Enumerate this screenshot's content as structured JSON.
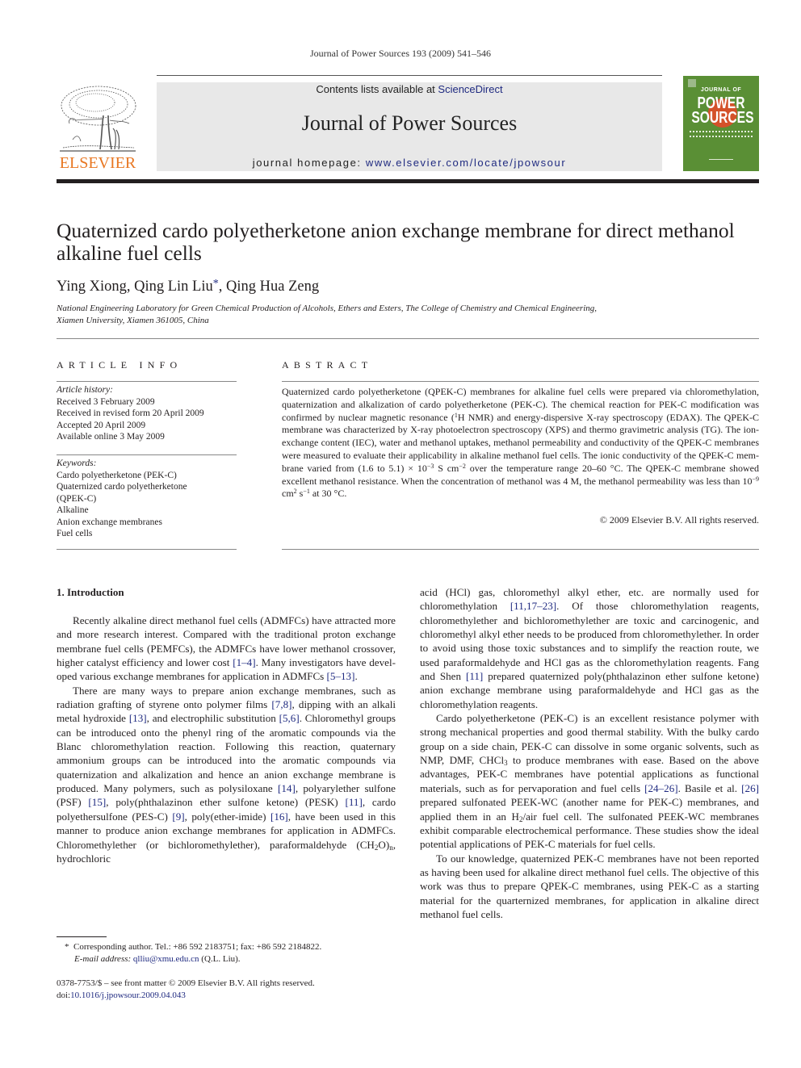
{
  "running_head": "Journal of Power Sources 193 (2009) 541–546",
  "publisher": {
    "logo_text": "ELSEVIER",
    "brand_color": "#e87722"
  },
  "banner": {
    "contents_prefix": "Contents lists available at ",
    "contents_link": "ScienceDirect",
    "journal_title": "Journal of Power Sources",
    "homepage_prefix": "journal homepage: ",
    "homepage_link": "www.elsevier.com/locate/jpowsour",
    "background": "#e8e8e8",
    "link_color": "#1f2a80"
  },
  "cover": {
    "small_title": "JOURNAL OF",
    "big_line1": "POWER",
    "big_line2": "SOURCES",
    "color": "#5a8f35"
  },
  "article": {
    "title": "Quaternized cardo polyetherketone anion exchange membrane for direct methanol alkaline fuel cells",
    "authors": [
      {
        "name": "Ying Xiong",
        "sep": ", "
      },
      {
        "name": "Qing Lin Liu",
        "mark": "*",
        "sep": ", "
      },
      {
        "name": "Qing Hua Zeng",
        "sep": ""
      }
    ],
    "affiliation_line1": "National Engineering Laboratory for Green Chemical Production of Alcohols, Ethers and Esters, The College of Chemistry and Chemical Engineering,",
    "affiliation_line2": "Xiamen University, Xiamen 361005, China"
  },
  "article_info": {
    "heading": "ARTICLE INFO",
    "history_label": "Article history:",
    "history": [
      "Received 3 February 2009",
      "Received in revised form 20 April 2009",
      "Accepted 20 April 2009",
      "Available online 3 May 2009"
    ],
    "keywords_label": "Keywords:",
    "keywords": [
      "Cardo polyetherketone (PEK-C)",
      "Quaternized cardo polyetherketone",
      "(QPEK-C)",
      "Alkaline",
      "Anion exchange membranes",
      "Fuel cells"
    ]
  },
  "abstract": {
    "heading": "ABSTRACT",
    "p1": "Quaternized cardo polyetherketone (QPEK-C) membranes for alkaline fuel cells were prepared via chloromethylation, quaternization and alkalization of cardo polyetherketone (PEK-C). The chemical reaction for PEK-C modification was confirmed by nuclear magnetic resonance (",
    "sup1": "1",
    "p2": "H NMR) and energy-dispersive X-ray spectroscopy (EDAX). The QPEK-C membrane was characterized by X-ray photoelectron spectroscopy (XPS) and thermo gravimetric analysis (TG). The ion-exchange content (IEC), water and methanol uptakes, methanol permeability and conductivity of the QPEK-C membranes were measured to evaluate their applicability in alkaline methanol fuel cells. The ionic conductivity of the QPEK-C mem­brane varied from (1.6 to 5.1) × 10",
    "sup2": "−3",
    "p3": " S cm",
    "sup3": "−2",
    "p4": " over the temperature range 20–60 °C. The QPEK-C membrane showed excellent methanol resistance. When the concentration of methanol was 4 M, the methanol permeability was less than 10",
    "sup4": "−9",
    "p5": " cm",
    "sup5": "2",
    "p6": " s",
    "sup6": "−1",
    "p7": " at 30 °C.",
    "copyright": "© 2009 Elsevier B.V. All rights reserved."
  },
  "intro": {
    "heading": "1.  Introduction",
    "col1": {
      "p1_a": "Recently alkaline direct methanol fuel cells (ADMFCs) have attracted more and more research interest. Compared with the traditional proton exchange membrane fuel cells (PEMFCs), the ADMFCs have lower methanol crossover, higher catalyst efficiency and lower cost ",
      "p1_ref1": "[1–4]",
      "p1_b": ". Many investigators have devel­oped various exchange membranes for application in ADMFCs ",
      "p1_ref2": "[5–13]",
      "p1_c": ".",
      "p2_a": "There are many ways to prepare anion exchange membranes, such as radiation grafting of styrene onto polymer films ",
      "p2_ref1": "[7,8]",
      "p2_b": ", dip­ping with an alkali metal hydroxide ",
      "p2_ref2": "[13]",
      "p2_c": ", and electrophilic substitu­tion ",
      "p2_ref3": "[5,6]",
      "p2_d": ". Chloromethyl groups can be introduced onto the phenyl ring of the aromatic compounds via the Blanc chloromethylation reaction. Following this reaction, quaternary ammonium groups can be introduced into the aromatic compounds via quaterniza­tion and alkalization and hence an anion exchange membrane is produced. Many polymers, such as polysiloxane ",
      "p2_ref4": "[14]",
      "p2_e": ", polyarylether sulfone (PSF) ",
      "p2_ref5": "[15]",
      "p2_f": ", poly(phthalazinon ether sulfone ketone) (PESK) ",
      "p2_ref6": "[11]",
      "p2_g": ", cardo polyethersulfone (PES-C) ",
      "p2_ref7": "[9]",
      "p2_h": ", poly(ether-imide) ",
      "p2_ref8": "[16]",
      "p2_i": ", have been used in this manner to produce anion exchange membranes for application in ADMFCs. Chloromethylether (or bichloromethylether), paraformaldehyde (CH",
      "p2_sub1": "2",
      "p2_j": "O)",
      "p2_sub2": "n",
      "p2_k": ", hydrochloric"
    },
    "col2": {
      "p1_a": "acid (HCl) gas, chloromethyl alkyl ether, etc. are normally used for chloromethylation ",
      "p1_ref1": "[11,17–23]",
      "p1_b": ". Of those chloromethylation reagents, chloromethylether and bichloromethylether are toxic and carcino­genic, and chloromethyl alkyl ether needs to be produced from chloromethylether. In order to avoid using those toxic substances and to simplify the reaction route, we used paraformaldehyde and HCl gas as the chloromethylation reagents. Fang and Shen ",
      "p1_ref2": "[11]",
      "p1_c": " pre­pared quaternized poly(phthalazinon ether sulfone ketone) anion exchange membrane using paraformaldehyde and HCl gas as the chloromethylation reagents.",
      "p2_a": "Cardo polyetherketone (PEK-C) is an excellent resistance poly­mer with strong mechanical properties and good thermal stability. With the bulky cardo group on a side chain, PEK-C can dissolve in some organic solvents, such as NMP, DMF, CHCl",
      "p2_sub1": "3",
      "p2_b": " to produce membranes with ease. Based on the above advantages, PEK-C mem­branes have potential applications as functional materials, such as for pervaporation and fuel cells ",
      "p2_ref1": "[24–26]",
      "p2_c": ". Basile et al. ",
      "p2_ref2": "[26]",
      "p2_d": " prepared sulfonated PEEK-WC (another name for PEK-C) membranes, and applied them in an H",
      "p2_sub2": "2",
      "p2_e": "/air fuel cell. The sulfonated PEEK-WC mem­branes exhibit comparable electrochemical performance. These studies show the ideal potential applications of PEK-C materials for fuel cells.",
      "p3": "To our knowledge, quaternized PEK-C membranes have not been reported as having been used for alkaline direct methanol fuel cells. The objective of this work was thus to prepare QPEK-C membranes, using PEK-C as a starting material for the quarternized membranes, for application in alkaline direct methanol fuel cells."
    }
  },
  "footnote": {
    "mark": "*",
    "text": "Corresponding author. Tel.: +86 592 2183751; fax: +86 592 2184822.",
    "email_label": "E-mail address:",
    "email": "qlliu@xmu.edu.cn",
    "email_suffix": " (Q.L. Liu)."
  },
  "front_matter": {
    "issn_line": "0378-7753/$ – see front matter © 2009 Elsevier B.V. All rights reserved.",
    "doi_prefix": "doi:",
    "doi": "10.1016/j.jpowsour.2009.04.043"
  }
}
